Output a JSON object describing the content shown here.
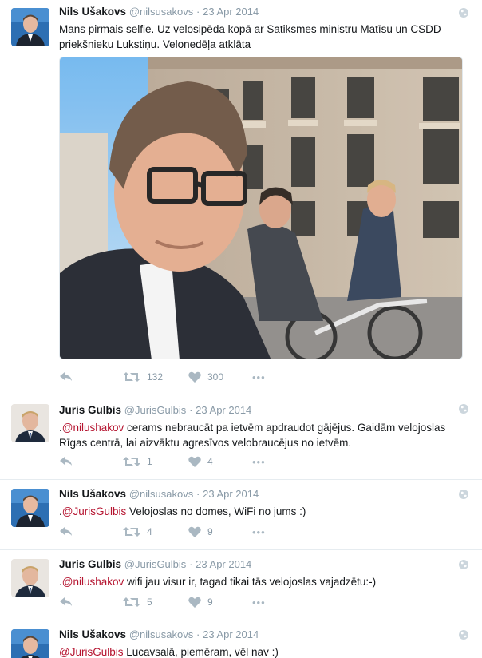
{
  "tweets": [
    {
      "name": "Nils Ušakovs",
      "handle": "@nilsusakovs",
      "sep": "·",
      "date": "23 Apr 2014",
      "mention": "",
      "text": "Mans pirmais selfie. Uz velosipēda kopā ar Satiksmes ministru Matīsu un CSDD priekšnieku Lukstiņu. Velonedēļa atklāta",
      "retweets": "132",
      "likes": "300",
      "more": "•••"
    },
    {
      "name": "Juris Gulbis",
      "handle": "@JurisGulbis",
      "sep": "·",
      "date": "23 Apr 2014",
      "prefix": ".",
      "mention": "@nilushakov",
      "text": " cerams nebraucāt pa ietvēm apdraudot gājējus. Gaidām velojoslas Rīgas centrā, lai aizvāktu agresīvos velobraucējus no ietvēm.",
      "retweets": "1",
      "likes": "4",
      "more": "•••"
    },
    {
      "name": "Nils Ušakovs",
      "handle": "@nilsusakovs",
      "sep": "·",
      "date": "23 Apr 2014",
      "prefix": ".",
      "mention": "@JurisGulbis",
      "text": " Velojoslas no domes, WiFi no jums :)",
      "retweets": "4",
      "likes": "9",
      "more": "•••"
    },
    {
      "name": "Juris Gulbis",
      "handle": "@JurisGulbis",
      "sep": "·",
      "date": "23 Apr 2014",
      "prefix": ".",
      "mention": "@nilushakov",
      "text": " wifi jau visur ir, tagad tikai tās velojoslas vajadzētu:-)",
      "retweets": "5",
      "likes": "9",
      "more": "•••"
    },
    {
      "name": "Nils Ušakovs",
      "handle": "@nilsusakovs",
      "sep": "·",
      "date": "23 Apr 2014",
      "prefix": "",
      "mention": "@JurisGulbis",
      "text": " Lucavsalā, piemēram, vēl nav :)",
      "retweets": "",
      "likes": "",
      "more": ""
    }
  ],
  "colors": {
    "mention": "#b5132f",
    "meta": "#8899a6",
    "icon": "#aab8c2",
    "divider": "#e6ecf0"
  }
}
